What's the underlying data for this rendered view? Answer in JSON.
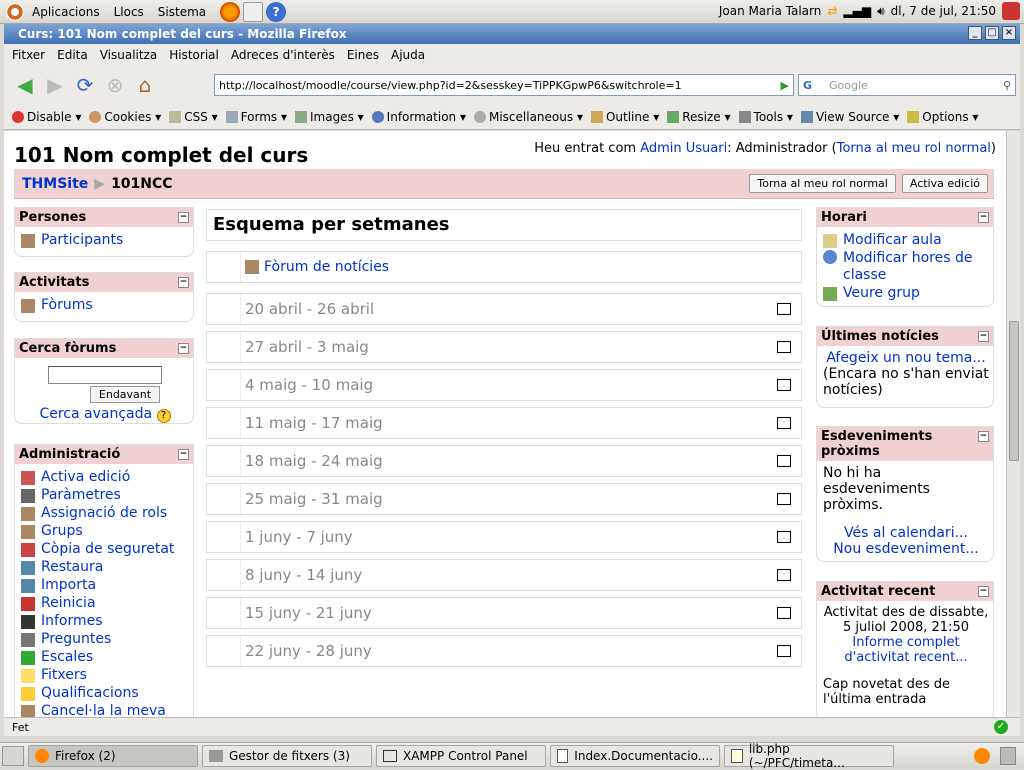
{
  "system": {
    "menus": [
      "Aplicacions",
      "Llocs",
      "Sistema"
    ],
    "user": "Joan Maria Talarn",
    "clock": "dl,  7 de jul, 21:50"
  },
  "window": {
    "title": "Curs: 101 Nom complet del curs - Mozilla Firefox"
  },
  "menubar": [
    "Fitxer",
    "Edita",
    "Visualitza",
    "Historial",
    "Adreces d'interès",
    "Eines",
    "Ajuda"
  ],
  "nav": {
    "url": "http://localhost/moodle/course/view.php?id=2&sesskey=TiPPKGpwP6&switchrole=1",
    "search_placeholder": "Google"
  },
  "devbar": [
    "Disable",
    "Cookies",
    "CSS",
    "Forms",
    "Images",
    "Information",
    "Miscellaneous",
    "Outline",
    "Resize",
    "Tools",
    "View Source",
    "Options"
  ],
  "page": {
    "course_title": "101 Nom complet del curs",
    "login_prefix": "Heu entrat com ",
    "login_user": "Admin Usuari",
    "login_role": ": Administrador (",
    "login_link": "Torna al meu rol normal",
    "login_suffix": ")",
    "crumb_site": "THMSite",
    "crumb_sep": "▶",
    "crumb_course": "101NCC",
    "btn_normal_role": "Torna al meu rol normal",
    "btn_edit": "Activa edició"
  },
  "left": {
    "persones": {
      "title": "Persones",
      "items": [
        "Participants"
      ]
    },
    "activitats": {
      "title": "Activitats",
      "items": [
        "Fòrums"
      ]
    },
    "cerca": {
      "title": "Cerca fòrums",
      "button": "Endavant",
      "advanced": "Cerca avançada"
    },
    "admin": {
      "title": "Administració",
      "items": [
        "Activa edició",
        "Paràmetres",
        "Assignació de rols",
        "Grups",
        "Còpia de seguretat",
        "Restaura",
        "Importa",
        "Reinicia",
        "Informes",
        "Preguntes",
        "Escales",
        "Fitxers",
        "Qualificacions",
        "Cancel·la la meva"
      ]
    }
  },
  "main": {
    "title": "Esquema per setmanes",
    "forum": "Fòrum de notícies",
    "weeks": [
      "20 abril - 26 abril",
      "27 abril - 3 maig",
      "4 maig - 10 maig",
      "11 maig - 17 maig",
      "18 maig - 24 maig",
      "25 maig - 31 maig",
      "1 juny - 7 juny",
      "8 juny - 14 juny",
      "15 juny - 21 juny",
      "22 juny - 28 juny"
    ]
  },
  "right": {
    "horari": {
      "title": "Horari",
      "items": [
        "Modificar aula",
        "Modificar hores de classe",
        "Veure grup"
      ]
    },
    "noticies": {
      "title": "Últimes notícies",
      "link": "Afegeix un nou tema...",
      "note": "(Encara no s'han enviat notícies)"
    },
    "esdeveniments": {
      "title": "Esdeveniments pròxims",
      "text": "No hi ha esdeveniments pròxims.",
      "link1": "Vés al calendari...",
      "link2": "Nou esdeveniment..."
    },
    "recent": {
      "title": "Activitat recent",
      "since": "Activitat des de dissabte, 5 juliol 2008, 21:50",
      "link": "Informe complet d'activitat recent...",
      "note": "Cap novetat des de l'última entrada"
    }
  },
  "status": "Fet",
  "taskbar": [
    "Firefox (2)",
    "Gestor de fitxers (3)",
    "XAMPP Control Panel",
    "Index.Documentacio....",
    "lib.php (~/PFC/timeta..."
  ]
}
